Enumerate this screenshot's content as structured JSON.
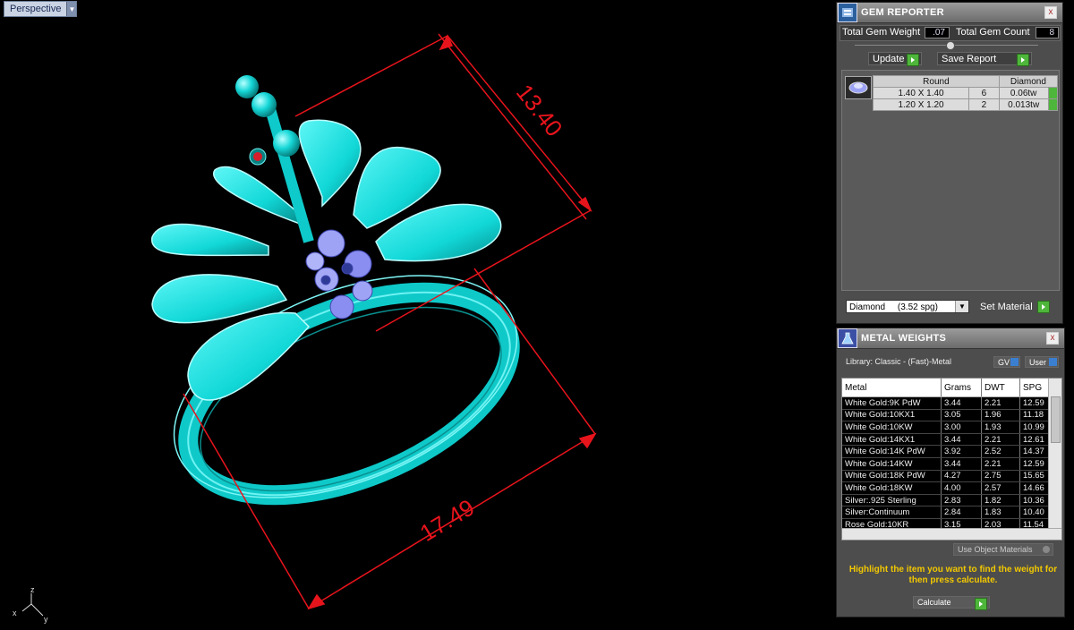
{
  "viewport": {
    "label": "Perspective",
    "dimension_top": "13.40",
    "dimension_bottom": "17.49",
    "axis": {
      "x": "x",
      "y": "y",
      "z": "z"
    }
  },
  "gem_reporter": {
    "title": "GEM REPORTER",
    "total_weight_label": "Total Gem Weight",
    "total_weight_value": ".07",
    "total_count_label": "Total Gem Count",
    "total_count_value": "8",
    "update_label": "Update",
    "save_report_label": "Save Report",
    "table": {
      "shape": "Round",
      "type": "Diamond",
      "rows": [
        {
          "size": "1.40 X 1.40",
          "count": "6",
          "weight": "0.06tw"
        },
        {
          "size": "1.20 X 1.20",
          "count": "2",
          "weight": "0.013tw"
        }
      ]
    },
    "material_select": "Diamond     (3.52 spg)",
    "set_material_label": "Set Material"
  },
  "metal_weights": {
    "title": "METAL WEIGHTS",
    "library": "Library: Classic - (Fast)-Metal",
    "gv_label": "GV",
    "user_label": "User",
    "columns": [
      "Metal",
      "Grams",
      "DWT",
      "SPG"
    ],
    "rows": [
      [
        "White Gold:9K PdW",
        "3.44",
        "2.21",
        "12.59"
      ],
      [
        "White Gold:10KX1",
        "3.05",
        "1.96",
        "11.18"
      ],
      [
        "White Gold:10KW",
        "3.00",
        "1.93",
        "10.99"
      ],
      [
        "White Gold:14KX1",
        "3.44",
        "2.21",
        "12.61"
      ],
      [
        "White Gold:14K PdW",
        "3.92",
        "2.52",
        "14.37"
      ],
      [
        "White Gold:14KW",
        "3.44",
        "2.21",
        "12.59"
      ],
      [
        "White Gold:18K PdW",
        "4.27",
        "2.75",
        "15.65"
      ],
      [
        "White Gold:18KW",
        "4.00",
        "2.57",
        "14.66"
      ],
      [
        "Silver:.925 Sterling",
        "2.83",
        "1.82",
        "10.36"
      ],
      [
        "Silver:Continuum",
        "2.84",
        "1.83",
        "10.40"
      ],
      [
        "Rose Gold:10KR",
        "3.15",
        "2.03",
        "11.54"
      ]
    ],
    "use_object_materials": "Use Object Materials",
    "note": "Highlight the item you want to find the weight for then press calculate.",
    "calculate_label": "Calculate"
  },
  "colors": {
    "model": "#10e0e0",
    "dimension": "#e8141c",
    "gem": "#8a8ef0"
  }
}
